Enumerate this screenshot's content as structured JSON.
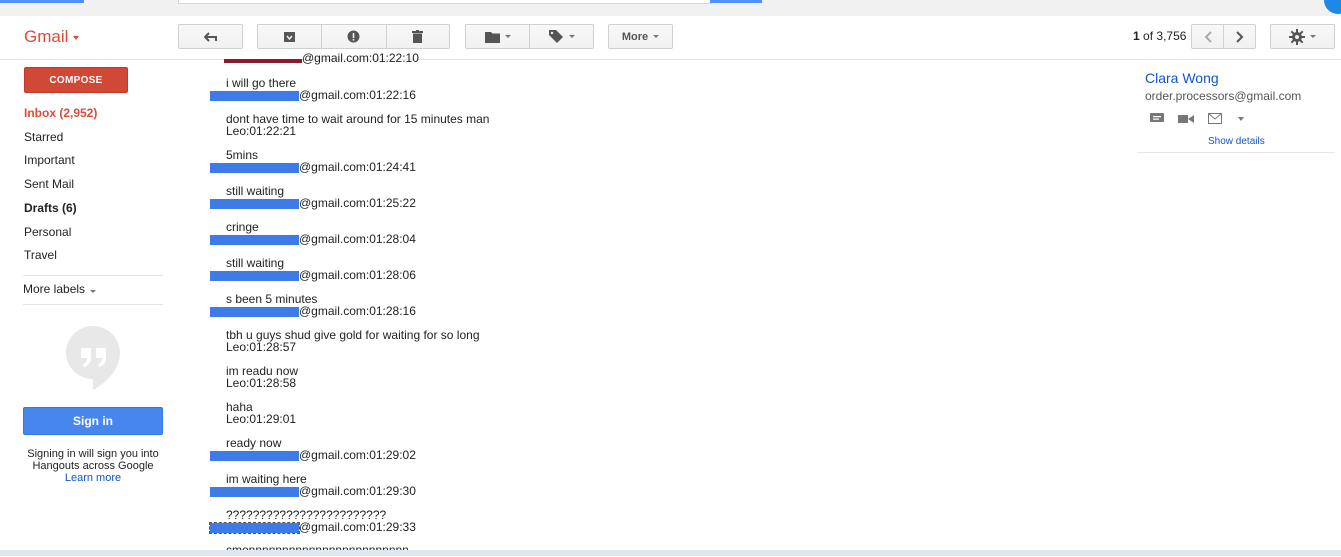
{
  "app": {
    "logo_text": "Gmail"
  },
  "toolbar": {
    "more_label": "More",
    "pager_range": "1",
    "pager_of": "of",
    "pager_total": "3,756"
  },
  "sidebar": {
    "compose_label": "COMPOSE",
    "items": [
      {
        "label": "Inbox (2,952)"
      },
      {
        "label": "Starred"
      },
      {
        "label": "Important"
      },
      {
        "label": "Sent Mail"
      },
      {
        "label": "Drafts (6)"
      },
      {
        "label": "Personal"
      },
      {
        "label": "Travel"
      }
    ],
    "more_labels": "More labels",
    "hangouts": {
      "signin_label": "Sign in",
      "signin_text": "Signing in will sign you into Hangouts across Google",
      "learn_more": "Learn more"
    }
  },
  "messages": [
    {
      "text": "",
      "sender": "@gmail.com:01:22:10",
      "redacted": true
    },
    {
      "text": "i will go there",
      "sender": "@gmail.com:01:22:16",
      "redacted": true
    },
    {
      "text": "dont have time to wait around for 15 minutes man",
      "sender": "Leo:01:22:21",
      "redacted": false
    },
    {
      "text": "5mins",
      "sender": "@gmail.com:01:24:41",
      "redacted": true
    },
    {
      "text": "still waiting",
      "sender": "@gmail.com:01:25:22",
      "redacted": true
    },
    {
      "text": "cringe",
      "sender": "@gmail.com:01:28:04",
      "redacted": true
    },
    {
      "text": "still waiting",
      "sender": "@gmail.com:01:28:06",
      "redacted": true
    },
    {
      "text": "s been 5 minutes",
      "sender": "@gmail.com:01:28:16",
      "redacted": true
    },
    {
      "text": "tbh u guys shud give gold for waiting for so long",
      "sender": "Leo:01:28:57",
      "redacted": false
    },
    {
      "text": "im readu now",
      "sender": "Leo:01:28:58",
      "redacted": false
    },
    {
      "text": "haha",
      "sender": "Leo:01:29:01",
      "redacted": false
    },
    {
      "text": "ready now",
      "sender": "@gmail.com:01:29:02",
      "redacted": true
    },
    {
      "text": "im waiting here",
      "sender": "@gmail.com:01:29:30",
      "redacted": true
    },
    {
      "text": "????????????????????????",
      "sender": "@gmail.com:01:29:33",
      "redacted": true
    },
    {
      "text": "cmonnnnnnnnnnnnnnnnnnnnnnnn",
      "sender": "",
      "redacted": false
    }
  ],
  "contact": {
    "name": "Clara Wong",
    "email": "order.processors@gmail.com",
    "show_details": "Show details"
  },
  "colors": {
    "brand_red": "#dd4b39",
    "compose_red": "#d14836",
    "signin_blue": "#4787ed",
    "link_blue": "#1155cc",
    "redaction_blue": "#3d7be8"
  }
}
